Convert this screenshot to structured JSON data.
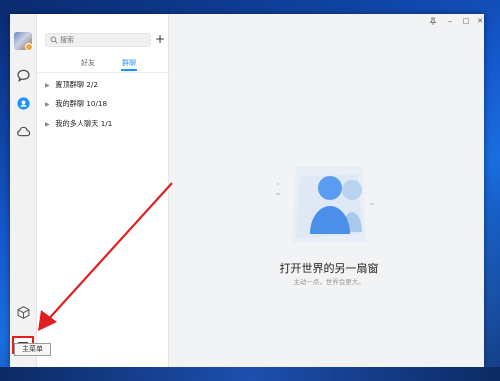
{
  "window": {
    "controls": {
      "pin": "📌",
      "minimize": "–",
      "maximize": "□",
      "close": "✕"
    }
  },
  "rail": {
    "icons": [
      "avatar",
      "message-icon",
      "contacts-icon",
      "cloud-icon",
      "cube-icon",
      "main-menu-icon"
    ],
    "active": "contacts-icon",
    "accent": "#1e90ff",
    "highlight_color": "#e02020"
  },
  "tooltip": {
    "label": "主菜单"
  },
  "search": {
    "placeholder": "搜索"
  },
  "add_button": {
    "label": "+"
  },
  "tabs": [
    {
      "label": "好友",
      "active": false
    },
    {
      "label": "群聊",
      "active": true
    }
  ],
  "groups": [
    {
      "name": "置顶群聊",
      "count": "2/2"
    },
    {
      "name": "我的群聊",
      "count": "10/18"
    },
    {
      "name": "我的多人聊天",
      "count": "1/1"
    }
  ],
  "empty_state": {
    "title": "打开世界的另一扇窗",
    "subtitle": "主动一点，世界会更大。"
  },
  "annotation": {
    "arrow_color": "#e02020"
  }
}
